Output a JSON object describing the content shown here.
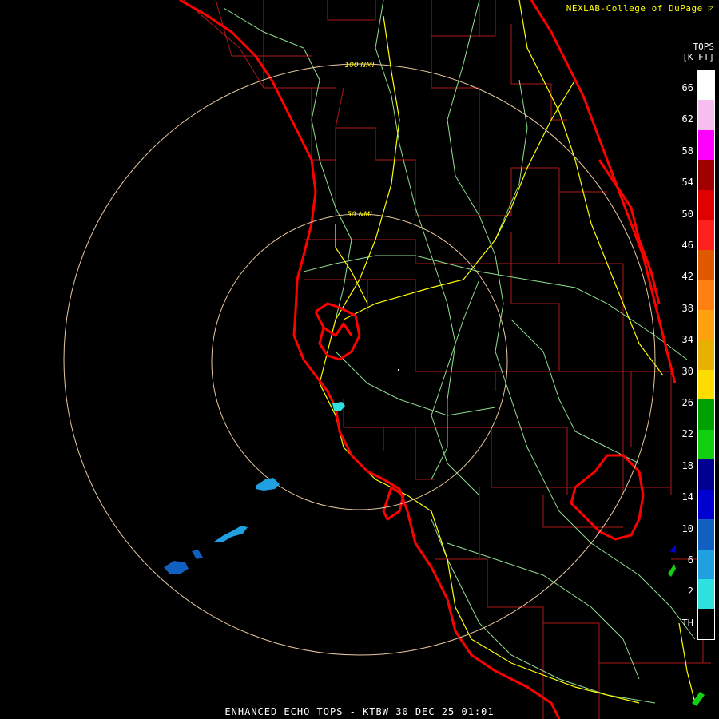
{
  "header": {
    "credit": "NEXLAB-College of DuPage",
    "credit_icon": "corner-arrow-icon"
  },
  "legend": {
    "title_line1": "TOPS",
    "title_line2": "[K FT]",
    "labels": [
      "66",
      "62",
      "58",
      "54",
      "50",
      "46",
      "42",
      "38",
      "34",
      "30",
      "26",
      "22",
      "18",
      "14",
      "10",
      "6",
      "2",
      "TH"
    ],
    "colors": [
      "#ffffff",
      "#f5bdf0",
      "#ff00ff",
      "#a00000",
      "#e00000",
      "#ff2020",
      "#e05800",
      "#ff8010",
      "#ffa010",
      "#e8b000",
      "#ffdc00",
      "#00a000",
      "#10d010",
      "#000090",
      "#0000d0",
      "#1060c0",
      "#20a0e0",
      "#30e0e0",
      "#000000"
    ]
  },
  "map": {
    "range_rings": [
      {
        "label": "100 NMI"
      },
      {
        "label": "50 NMI"
      }
    ],
    "colors": {
      "coastline": "#ff0000",
      "county": "#b01818",
      "highway": "#ffff00",
      "river": "#90e090",
      "ring": "#e8c8a0"
    }
  },
  "footer": {
    "title": "ENHANCED ECHO TOPS - KTBW 30 DEC 25 01:01"
  }
}
